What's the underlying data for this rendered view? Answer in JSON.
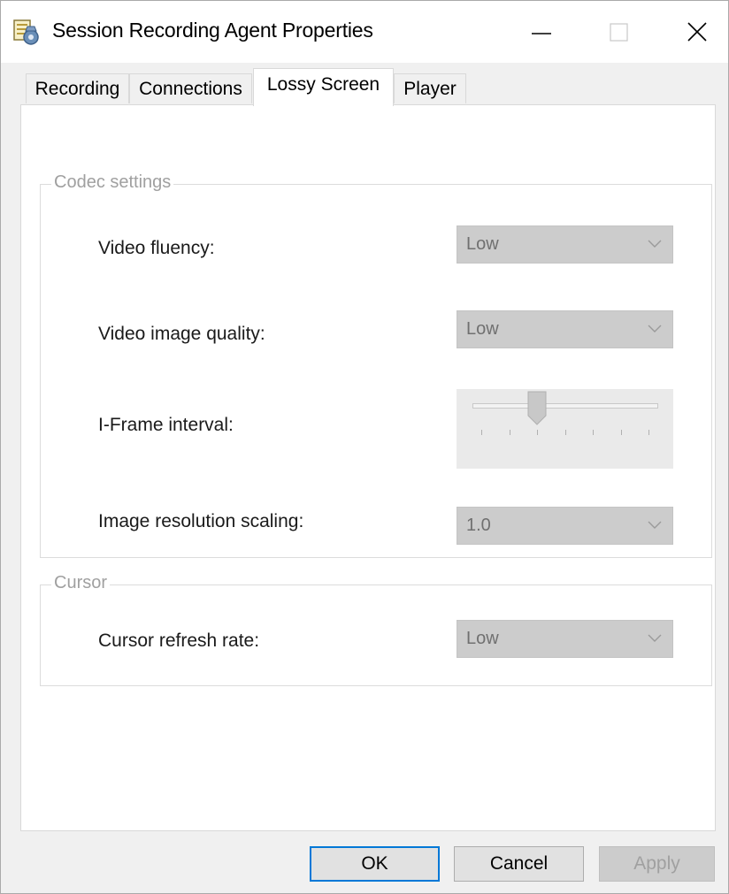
{
  "window": {
    "title": "Session Recording Agent Properties",
    "minimize_icon": "minimize-icon",
    "maximize_icon": "maximize-icon",
    "close_icon": "close-icon"
  },
  "tabs": [
    {
      "label": "Recording",
      "selected": false
    },
    {
      "label": "Connections",
      "selected": false
    },
    {
      "label": "Lossy Screen",
      "selected": true
    },
    {
      "label": "Player",
      "selected": false
    }
  ],
  "codec_settings": {
    "legend": "Codec settings",
    "video_fluency": {
      "label": "Video fluency:",
      "value": "Low",
      "enabled": false
    },
    "video_image_quality": {
      "label": "Video image quality:",
      "value": "Low",
      "enabled": false
    },
    "iframe_interval": {
      "label": "I-Frame interval:",
      "tick_count": 7,
      "selected_tick_index": 2,
      "enabled": false
    },
    "image_resolution_scaling": {
      "label": "Image resolution scaling:",
      "value": "1.0",
      "enabled": false
    }
  },
  "cursor": {
    "legend": "Cursor",
    "cursor_refresh_rate": {
      "label": "Cursor refresh rate:",
      "value": "Low",
      "enabled": false
    }
  },
  "buttons": {
    "ok": "OK",
    "cancel": "Cancel",
    "apply": "Apply",
    "apply_enabled": false
  },
  "colors": {
    "accent": "#0078d7",
    "disabled_text": "#a0a0a0"
  }
}
